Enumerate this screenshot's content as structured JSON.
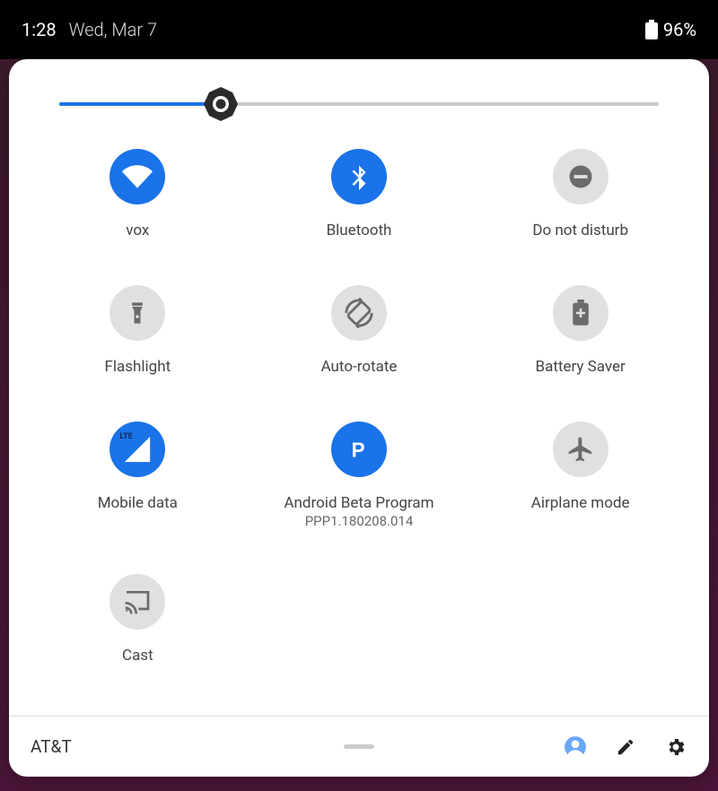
{
  "statusbar": {
    "time": "1:28",
    "date": "Wed, Mar 7",
    "battery_percent": "96%"
  },
  "brightness": {
    "percent": 27
  },
  "tiles": [
    {
      "id": "wifi",
      "label": "vox",
      "sub": "",
      "active": true
    },
    {
      "id": "bluetooth",
      "label": "Bluetooth",
      "sub": "",
      "active": true
    },
    {
      "id": "dnd",
      "label": "Do not disturb",
      "sub": "",
      "active": false
    },
    {
      "id": "flashlight",
      "label": "Flashlight",
      "sub": "",
      "active": false
    },
    {
      "id": "autorotate",
      "label": "Auto-rotate",
      "sub": "",
      "active": false
    },
    {
      "id": "battsaver",
      "label": "Battery Saver",
      "sub": "",
      "active": false
    },
    {
      "id": "mobiledata",
      "label": "Mobile data",
      "sub": "",
      "active": true
    },
    {
      "id": "beta",
      "label": "Android Beta Program",
      "sub": "PPP1.180208.014",
      "active": true
    },
    {
      "id": "airplane",
      "label": "Airplane mode",
      "sub": "",
      "active": false
    },
    {
      "id": "cast",
      "label": "Cast",
      "sub": "",
      "active": false
    }
  ],
  "footer": {
    "carrier": "AT&T"
  },
  "colors": {
    "accent": "#1a73e8",
    "inactive_bg": "#e0e0e0",
    "inactive_fg": "#6b6b6b"
  }
}
